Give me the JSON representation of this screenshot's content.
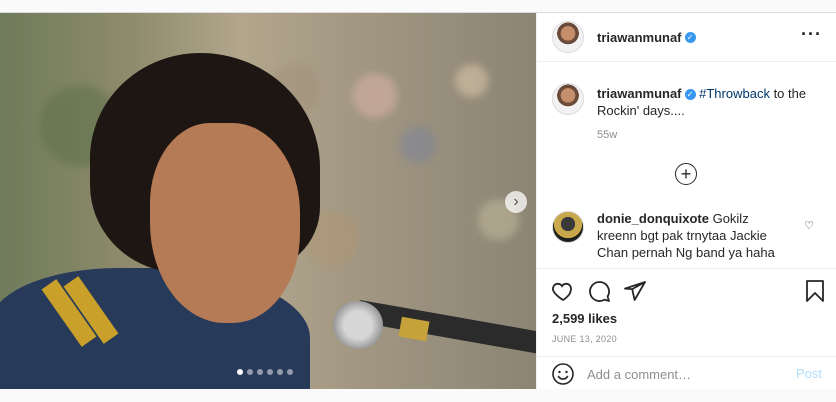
{
  "post": {
    "author": {
      "username": "triawanmunaf",
      "verified_icon": "verified-badge-icon"
    },
    "more_icon": "more-options-icon",
    "caption": {
      "username": "triawanmunaf",
      "hashtag": "#Throwback",
      "text": " to the Rockin' days...."
    },
    "time_ago": "55w",
    "load_more_icon": "add-circle-icon",
    "comments": [
      {
        "username": "donie_donquixote",
        "text": "Gokilz kreenn bgt pak trnytaa Jackie Chan pernah Ng band ya haha"
      }
    ],
    "carousel": {
      "next_icon": "chevron-right-icon",
      "slide_count": 6,
      "active_slide": 1
    },
    "actions": {
      "like_icon": "heart-icon",
      "comment_icon": "comment-icon",
      "share_icon": "share-icon",
      "save_icon": "bookmark-icon"
    },
    "likes": "2,599 likes",
    "date": "JUNE 13, 2020",
    "add_comment": {
      "emoji_icon": "emoji-icon",
      "placeholder": "Add a comment…",
      "post_label": "Post"
    }
  }
}
